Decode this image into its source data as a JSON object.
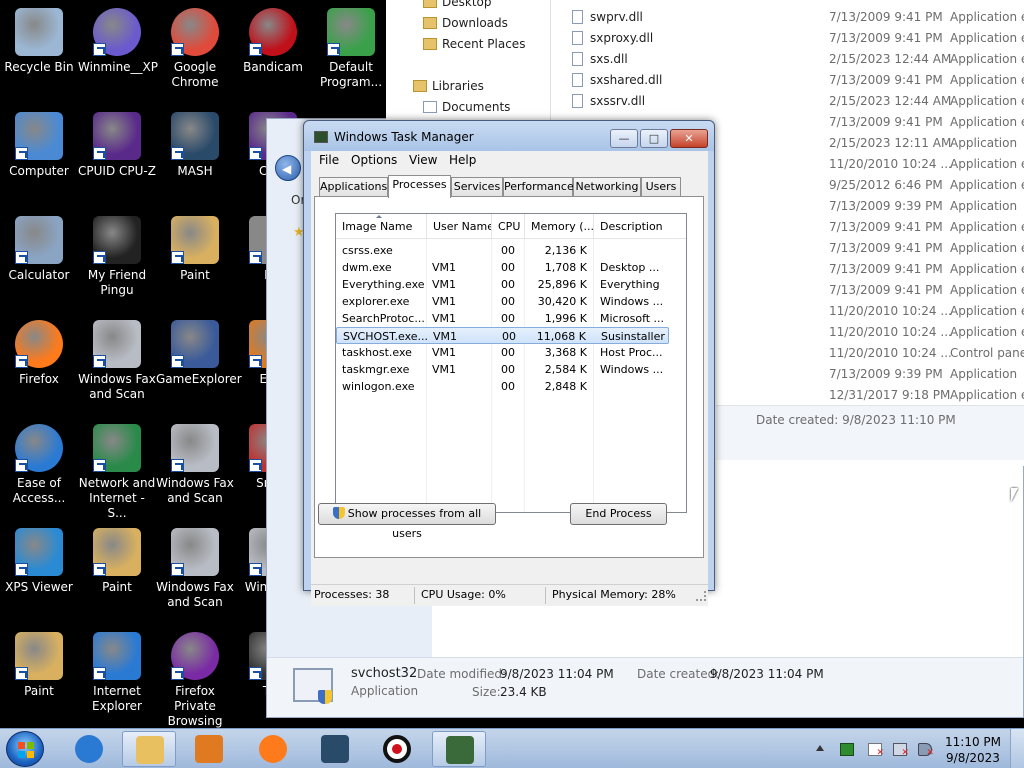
{
  "desktop_icons": [
    {
      "label": "Recycle Bin",
      "icon": "recycle-bin-icon"
    },
    {
      "label": "Winmine__XP",
      "icon": "mine-icon"
    },
    {
      "label": "Google Chrome",
      "icon": "chrome-icon"
    },
    {
      "label": "Bandicam",
      "icon": "bandicam-icon"
    },
    {
      "label": "Default Program...",
      "icon": "default-programs-icon"
    },
    {
      "label": "Computer",
      "icon": "computer-icon"
    },
    {
      "label": "CPUID CPU-Z",
      "icon": "cpuz-icon"
    },
    {
      "label": "MASH",
      "icon": "mash-icon"
    },
    {
      "label": "CPUI",
      "icon": "cpuz-icon"
    },
    {
      "label": "Calculator",
      "icon": "calculator-icon"
    },
    {
      "label": "My Friend Pingu",
      "icon": "pingu-icon"
    },
    {
      "label": "Paint",
      "icon": "paint-icon"
    },
    {
      "label": "Ma",
      "icon": "generic-app-icon"
    },
    {
      "label": "Firefox",
      "icon": "firefox-icon"
    },
    {
      "label": "Windows Fax and Scan",
      "icon": "fax-icon"
    },
    {
      "label": "GameExplorer",
      "icon": "game-explorer-icon"
    },
    {
      "label": "Ever",
      "icon": "everything-icon"
    },
    {
      "label": "Ease of Access...",
      "icon": "ease-of-access-icon"
    },
    {
      "label": "Network and Internet - S...",
      "icon": "network-icon"
    },
    {
      "label": "Windows Fax and Scan",
      "icon": "fax-icon"
    },
    {
      "label": "Snipp",
      "icon": "snipping-icon"
    },
    {
      "label": "XPS Viewer",
      "icon": "xps-icon"
    },
    {
      "label": "Paint",
      "icon": "paint-icon"
    },
    {
      "label": "Windows Fax and Scan",
      "icon": "fax-icon"
    },
    {
      "label": "Wind and",
      "icon": "fax-icon"
    },
    {
      "label": "Paint",
      "icon": "paint-icon"
    },
    {
      "label": "Internet Explorer",
      "icon": "ie-icon"
    },
    {
      "label": "Firefox Private Browsing",
      "icon": "firefox-private-icon"
    },
    {
      "label": "Tux",
      "icon": "tux-icon"
    }
  ],
  "explorer": {
    "nav": [
      "Desktop",
      "Downloads",
      "Recent Places",
      "Libraries",
      "Documents"
    ],
    "files": [
      {
        "name": "swprv.dll",
        "date": "7/13/2009 9:41 PM",
        "type": "Application ex"
      },
      {
        "name": "sxproxy.dll",
        "date": "7/13/2009 9:41 PM",
        "type": "Application ex"
      },
      {
        "name": "sxs.dll",
        "date": "2/15/2023 12:44 AM",
        "type": "Application ex"
      },
      {
        "name": "sxshared.dll",
        "date": "7/13/2009 9:41 PM",
        "type": "Application ex"
      },
      {
        "name": "sxssrv.dll",
        "date": "2/15/2023 12:44 AM",
        "type": "Application ex"
      },
      {
        "name": "",
        "date": "7/13/2009 9:41 PM",
        "type": "Application ex"
      },
      {
        "name": "",
        "date": "2/15/2023 12:11 AM",
        "type": "Application"
      },
      {
        "name": "",
        "date": "11/20/2010 10:24 ...",
        "type": "Application ex"
      },
      {
        "name": "",
        "date": "9/25/2012 6:46 PM",
        "type": "Application ex"
      },
      {
        "name": "",
        "date": "7/13/2009 9:39 PM",
        "type": "Application"
      },
      {
        "name": "",
        "date": "7/13/2009 9:41 PM",
        "type": "Application ex"
      },
      {
        "name": "",
        "date": "7/13/2009 9:41 PM",
        "type": "Application ex"
      },
      {
        "name": "",
        "date": "7/13/2009 9:41 PM",
        "type": "Application ex"
      },
      {
        "name": "",
        "date": "7/13/2009 9:41 PM",
        "type": "Application ex"
      },
      {
        "name": "",
        "date": "11/20/2010 10:24 ...",
        "type": "Application ex"
      },
      {
        "name": "",
        "date": "11/20/2010 10:24 ...",
        "type": "Application ex"
      },
      {
        "name": "",
        "date": "11/20/2010 10:24 ...",
        "type": "Control panel"
      },
      {
        "name": "",
        "date": "7/13/2009 9:39 PM",
        "type": "Application"
      },
      {
        "name": "",
        "date": "12/31/2017 9:18 PM",
        "type": "Application ex"
      }
    ],
    "details_created": "Date created: 9/8/2023 11:10 PM",
    "lower_details": {
      "name": "svchost32",
      "type": "Application",
      "modified_label": "Date modified:",
      "modified": "9/8/2023 11:04 PM",
      "created_label": "Date created:",
      "created": "9/8/2023 11:04 PM",
      "size_label": "Size:",
      "size": "23.4 KB"
    },
    "partial_labels": {
      "or": "Or"
    }
  },
  "task_manager": {
    "title": "Windows Task Manager",
    "menu": [
      "File",
      "Options",
      "View",
      "Help"
    ],
    "tabs": [
      "Applications",
      "Processes",
      "Services",
      "Performance",
      "Networking",
      "Users"
    ],
    "active_tab": "Processes",
    "columns": [
      "Image Name",
      "User Name",
      "CPU",
      "Memory (...",
      "Description"
    ],
    "rows": [
      {
        "image": "csrss.exe",
        "user": "",
        "cpu": "00",
        "mem": "2,136 K",
        "desc": ""
      },
      {
        "image": "dwm.exe",
        "user": "VM1",
        "cpu": "00",
        "mem": "1,708 K",
        "desc": "Desktop ..."
      },
      {
        "image": "Everything.exe",
        "user": "VM1",
        "cpu": "00",
        "mem": "25,896 K",
        "desc": "Everything"
      },
      {
        "image": "explorer.exe",
        "user": "VM1",
        "cpu": "00",
        "mem": "30,420 K",
        "desc": "Windows ..."
      },
      {
        "image": "SearchProtoc...",
        "user": "VM1",
        "cpu": "00",
        "mem": "1,996 K",
        "desc": "Microsoft ..."
      },
      {
        "image": "SVCHOST.exe...",
        "user": "VM1",
        "cpu": "00",
        "mem": "11,068 K",
        "desc": "Susinstaller"
      },
      {
        "image": "taskhost.exe",
        "user": "VM1",
        "cpu": "00",
        "mem": "3,368 K",
        "desc": "Host Proc..."
      },
      {
        "image": "taskmgr.exe",
        "user": "VM1",
        "cpu": "00",
        "mem": "2,584 K",
        "desc": "Windows ..."
      },
      {
        "image": "winlogon.exe",
        "user": "",
        "cpu": "00",
        "mem": "2,848 K",
        "desc": ""
      }
    ],
    "selected_row": 5,
    "show_all_button": "Show processes from all users",
    "end_process_button": "End Process",
    "status": {
      "processes": "Processes: 38",
      "cpu": "CPU Usage: 0%",
      "memory": "Physical Memory: 28%"
    }
  },
  "taskbar": {
    "time": "11:10 PM",
    "date": "9/8/2023",
    "pinned": [
      "ie-icon",
      "explorer-icon",
      "media-player-icon",
      "firefox-icon",
      "mash-icon",
      "bandicam-icon",
      "task-manager-icon"
    ]
  }
}
